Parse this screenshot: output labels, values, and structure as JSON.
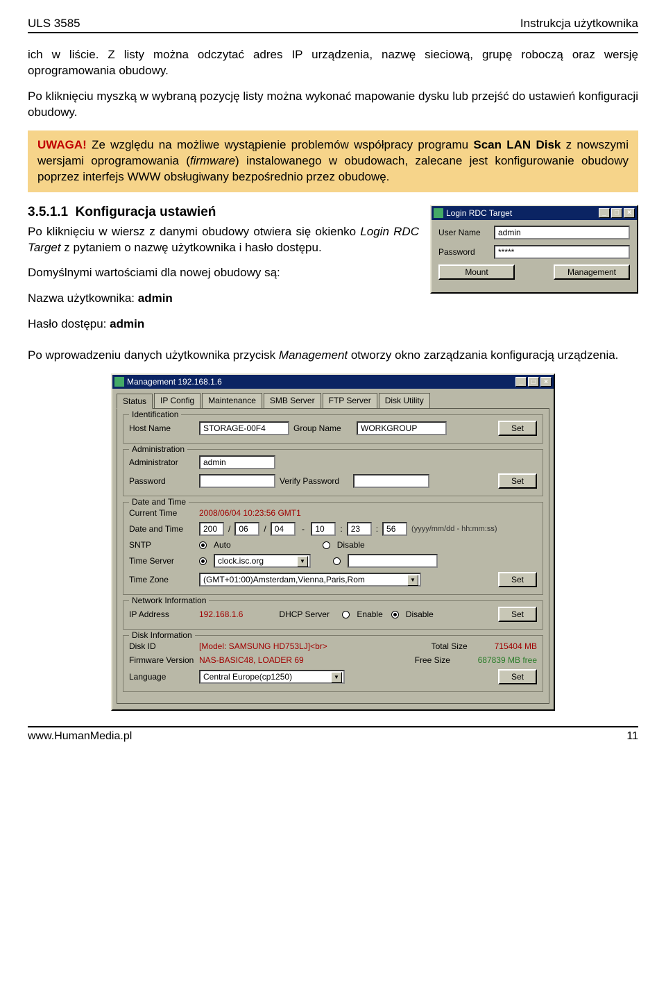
{
  "header": {
    "left": "ULS 3585",
    "right": "Instrukcja użytkownika"
  },
  "para1": "ich w liście. Z listy można odczytać adres IP urządzenia, nazwę sieciową, grupę roboczą oraz wersję oprogramowania obudowy.",
  "para2": "Po kliknięciu myszką w wybraną pozycję listy można wykonać mapowanie dysku lub przejść do ustawień konfiguracji obudowy.",
  "warn": {
    "uwaga": "UWAGA!",
    "text_before_prog": " Ze względu na możliwe wystąpienie problemów współpracy programu ",
    "prog": "Scan LAN Disk",
    "text_after_prog": " z nowszymi wersjami oprogramowania (",
    "fw": "firmware",
    "text_tail": ") instalowanego w obudowach, zalecane jest konfigurowanie obudowy poprzez interfejs WWW obsługiwany bezpośrednio przez obudowę."
  },
  "section": {
    "num": "3.5.1.1",
    "title": "Konfiguracja ustawień",
    "p1a": "Po kliknięciu w wiersz z danymi obudowy otwiera się okienko ",
    "p1b": "Login RDC Target",
    "p1c": " z pytaniem o nazwę użytkownika i hasło dostępu.",
    "p2": "Domyślnymi wartościami dla nowej obudowy są:",
    "p3a": "Nazwa użytkownika: ",
    "p3b": "admin",
    "p4a": "Hasło dostępu: ",
    "p4b": "admin",
    "p5a": "Po wprowadzeniu danych użytkownika przycisk ",
    "p5b": "Management",
    "p5c": " otworzy okno zarządzania konfiguracją urządzenia."
  },
  "login_win": {
    "title": "Login RDC Target",
    "user_label": "User Name",
    "user_value": "admin",
    "pass_label": "Password",
    "pass_value": "*****",
    "btn_mount": "Mount",
    "btn_mgmt": "Management"
  },
  "mgmt_win": {
    "title": "Management 192.168.1.6",
    "tabs": [
      "Status",
      "IP Config",
      "Maintenance",
      "SMB Server",
      "FTP Server",
      "Disk Utility"
    ],
    "ident": {
      "legend": "Identification",
      "host_label": "Host Name",
      "host_value": "STORAGE-00F4",
      "group_label": "Group Name",
      "group_value": "WORKGROUP",
      "set": "Set"
    },
    "admin": {
      "legend": "Administration",
      "admin_label": "Administrator",
      "admin_value": "admin",
      "pass_label": "Password",
      "verify_label": "Verify Password",
      "set": "Set"
    },
    "dt": {
      "legend": "Date and Time",
      "current_label": "Current Time",
      "current_value": "2008/06/04 10:23:56 GMT1",
      "date_label": "Date and Time",
      "yyyy": "200",
      "mm": "06",
      "dd": "04",
      "hh": "10",
      "mi": "23",
      "ss": "56",
      "fmt": "(yyyy/mm/dd - hh:mm:ss)",
      "sntp_label": "SNTP",
      "auto": "Auto",
      "disable": "Disable",
      "ts_label": "Time Server",
      "ts_value": "clock.isc.org",
      "tz_label": "Time Zone",
      "tz_value": "(GMT+01:00)Amsterdam,Vienna,Paris,Rom",
      "set": "Set"
    },
    "net": {
      "legend": "Network Information",
      "ip_label": "IP Address",
      "ip_value": "192.168.1.6",
      "dhcp_label": "DHCP Server",
      "enable": "Enable",
      "disable": "Disable",
      "set": "Set"
    },
    "disk": {
      "legend": "Disk Information",
      "id_label": "Disk ID",
      "id_value": "[Model: SAMSUNG HD753LJ]<br>",
      "total_label": "Total Size",
      "total_value": "715404 MB",
      "fw_label": "Firmware Version",
      "fw_value": "NAS-BASIC48, LOADER  69",
      "free_label": "Free Size",
      "free_value": "687839 MB free",
      "lang_label": "Language",
      "lang_value": "Central Europe(cp1250)",
      "set": "Set"
    }
  },
  "footer": {
    "left": "www.HumanMedia.pl",
    "right": "11"
  }
}
